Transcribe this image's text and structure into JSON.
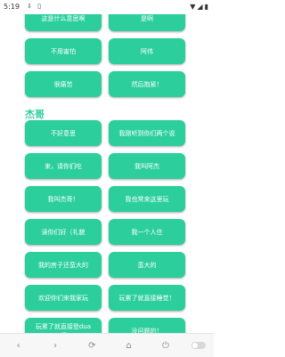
{
  "status": {
    "time": "5:19",
    "left_icons": "⇩ ▯",
    "right_icons": "▼◢▮"
  },
  "top_buttons": [
    "这是什么意思啊",
    "是啊",
    "不用害怕",
    "阿伟",
    "很痛苦",
    "然后抱紧！"
  ],
  "section": {
    "title": "杰哥"
  },
  "buttons": [
    "不好意思",
    "我刚听到你们两个说",
    "来，请你们吃",
    "我叫阿杰",
    "我叫杰哥！",
    "我也常来这里玩",
    "读你们好（礼貌",
    "我一个人住",
    "我的房子还蛮大的",
    "蛮大的",
    "欢迎你们来我家玩",
    "玩累了就直接睡觉！",
    "玩累了就直接登dua\n都",
    "没问题的！"
  ],
  "nav": {
    "back": "‹",
    "forward": "›",
    "refresh": "⟳",
    "home": "⌂",
    "power": "⏻"
  }
}
